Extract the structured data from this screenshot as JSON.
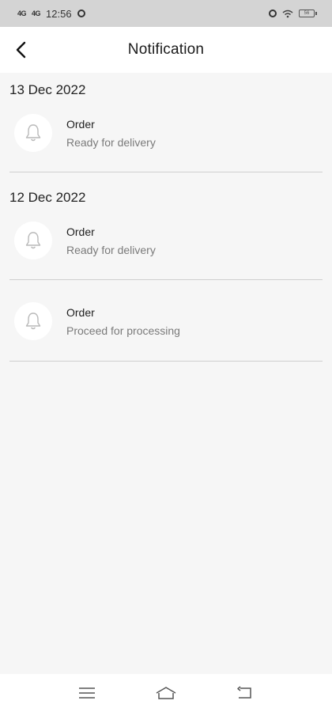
{
  "status_bar": {
    "signal_1": "4G",
    "signal_2": "4G",
    "time": "12:56",
    "battery": "56"
  },
  "header": {
    "title": "Notification"
  },
  "groups": [
    {
      "date": "13 Dec 2022",
      "items": [
        {
          "title": "Order",
          "subtitle": "Ready for delivery",
          "icon": "bell-icon"
        }
      ]
    },
    {
      "date": "12 Dec 2022",
      "items": [
        {
          "title": "Order",
          "subtitle": "Ready for delivery",
          "icon": "bell-icon"
        },
        {
          "title": "Order",
          "subtitle": "Proceed for processing",
          "icon": "bell-icon"
        }
      ]
    }
  ],
  "bottom_nav": {
    "icons": [
      "menu-icon",
      "home-icon",
      "back-icon"
    ]
  }
}
